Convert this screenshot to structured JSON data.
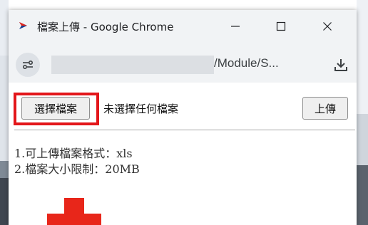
{
  "window": {
    "title": "檔案上傳 - Google Chrome",
    "url_visible": "/Module/S..."
  },
  "icons": {
    "app": "chrome-app-icon",
    "minimize": "minimize-icon",
    "maximize": "maximize-icon",
    "close": "close-icon",
    "site_info": "site-info-icon",
    "download": "download-icon",
    "annotation_arrow": "down-arrow-icon"
  },
  "form": {
    "choose_button_label": "選擇檔案",
    "no_file_text": "未選擇任何檔案",
    "upload_button_label": "上傳"
  },
  "notes": [
    "1.可上傳檔案格式：xls",
    "2.檔案大小限制：20MB"
  ],
  "colors": {
    "highlight": "#e3161a",
    "arrow": "#e8261a"
  }
}
